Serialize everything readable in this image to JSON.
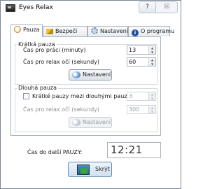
{
  "window": {
    "title": "Eyes Relax",
    "help_glyph": "?",
    "close_glyph": "☒"
  },
  "tabs": [
    {
      "label": "Pauza",
      "icon": "clock-icon",
      "active": true
    },
    {
      "label": "Bezpečí",
      "icon": "key-icon",
      "active": false
    },
    {
      "label": "Nastavení",
      "icon": "gear-icon",
      "active": false
    },
    {
      "label": "O programu",
      "icon": "info-icon",
      "active": false
    }
  ],
  "short_pause": {
    "legend": "Krátká pauza",
    "work_time_label": "Čas pro práci (minuty)",
    "work_time_value": "13",
    "relax_label": "Čas pro relax očí (sekundy)",
    "relax_value": "60",
    "settings_button": "Nastavení"
  },
  "long_pause": {
    "legend": "Dlouhá pauza",
    "checkbox_label": "Krátké pauzy mezi dlouhými pauzami",
    "checkbox_checked": false,
    "between_value": "3",
    "relax_label": "Čas pro relax očí (sekundy)",
    "relax_value": "300",
    "settings_button": "Nastavení"
  },
  "countdown": {
    "label": "Čas do další PAUZY:",
    "value": "12:21"
  },
  "hide_button": {
    "label": "Skrýt",
    "icon": "monitor-icon"
  },
  "icons": {
    "arrow_up": "▲",
    "arrow_down": "▼",
    "info_letter": "i"
  }
}
